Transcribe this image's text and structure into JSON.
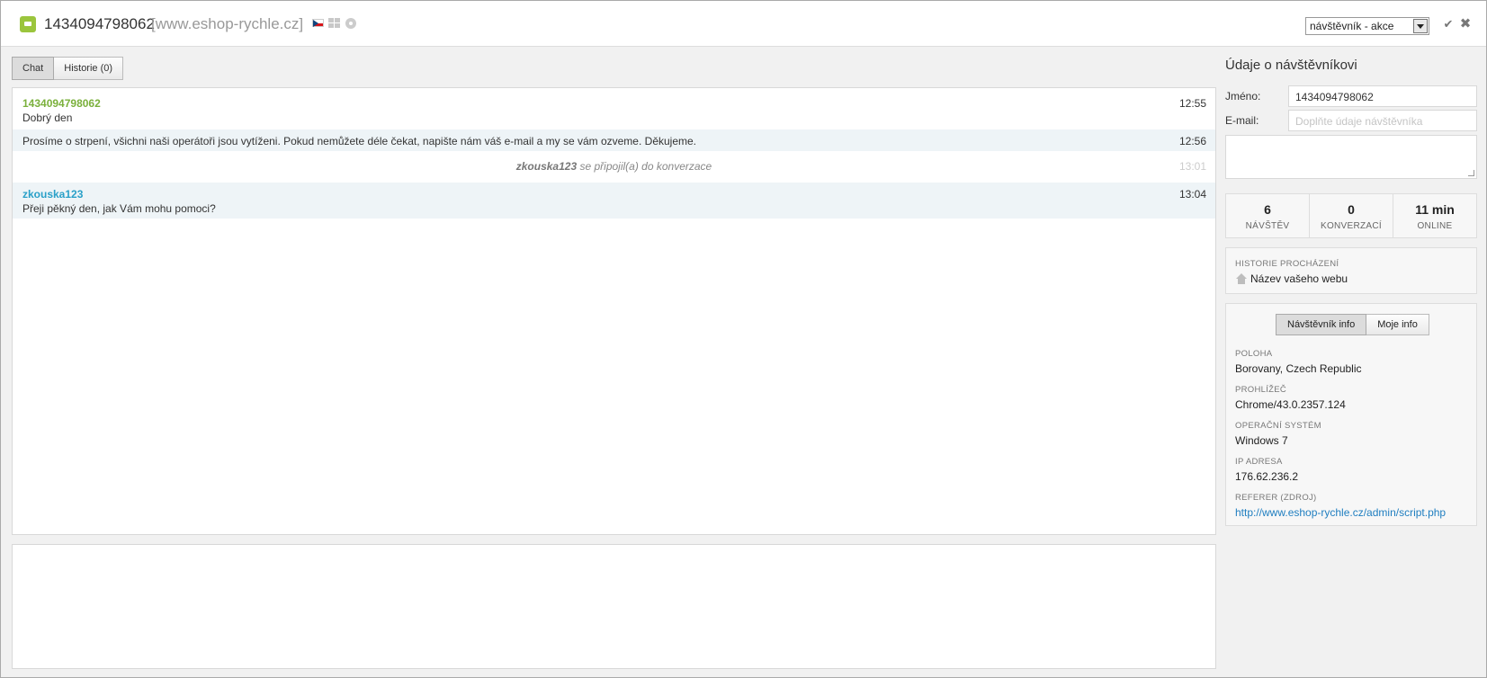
{
  "header": {
    "visitor_id": "1434094798062",
    "site": "[www.eshop-rychle.cz]",
    "status_select": "návštěvník - akce"
  },
  "tabs": [
    {
      "label": "Chat"
    },
    {
      "label": "Historie (0)"
    }
  ],
  "messages": [
    {
      "author": "1434094798062",
      "text": "Dobrý den",
      "time": "12:55"
    },
    {
      "text": "Prosíme o strpení, všichni naši operátoři jsou vytíženi. Pokud nemůžete déle čekat, napište nám váš e-mail a my se vám ozveme. Děkujeme.",
      "time": "12:56"
    },
    {
      "author": "zkouska123",
      "text": "se připojil(a) do konverzace",
      "time": "13:01"
    },
    {
      "author": "zkouska123",
      "text": "Přeji pěkný den, jak Vám mohu pomoci?",
      "time": "13:04"
    }
  ],
  "visitor_panel": {
    "title": "Údaje o návštěvníkovi",
    "name_label": "Jméno:",
    "name_value": "1434094798062",
    "email_label": "E-mail:",
    "email_placeholder": "Doplňte údaje návštěvníka",
    "stats": [
      {
        "value": "6",
        "caption": "NÁVŠTĚV"
      },
      {
        "value": "0",
        "caption": "KONVERZACÍ"
      },
      {
        "value": "11 min",
        "caption": "ONLINE"
      }
    ],
    "history_caption": "HISTORIE PROCHÁZENÍ",
    "history_page": "Název vašeho webu",
    "info_tabs": [
      {
        "label": "Návštěvník info"
      },
      {
        "label": "Moje info"
      }
    ],
    "info": [
      {
        "label": "POLOHA",
        "value": "Borovany, Czech Republic"
      },
      {
        "label": "PROHLÍŽEČ",
        "value": "Chrome/43.0.2357.124"
      },
      {
        "label": "OPERAČNÍ SYSTÉM",
        "value": "Windows 7"
      },
      {
        "label": "IP ADRESA",
        "value": "176.62.236.2"
      },
      {
        "label": "REFERER (ZDROJ)",
        "value": "http://www.eshop-rychle.cz/admin/script.php"
      }
    ]
  },
  "colors": {
    "visitor_name": "#7ab03b",
    "operator_name": "#2aa0c8",
    "link": "#1f7ec0",
    "system_row_bg": "#eef4f7"
  },
  "icons": {
    "app": "chat-bubble-icon",
    "flag": "czech-flag-icon",
    "os": "windows-icon",
    "browser": "chrome-icon",
    "minimize": "chevron-down-icon",
    "close": "close-icon",
    "history": "home-icon"
  }
}
